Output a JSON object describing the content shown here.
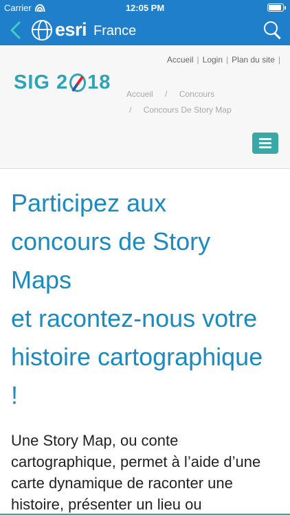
{
  "status_bar": {
    "carrier": "Carrier",
    "time": "12:05 PM",
    "battery_level": 0.9
  },
  "nav": {
    "brand": "esri",
    "region": "France",
    "colors": {
      "bar": "#1f7fcb"
    }
  },
  "header": {
    "top_links": [
      "Accueil",
      "Login",
      "Plan du site"
    ],
    "logo_text_left": "SIG 2",
    "logo_text_right": "18",
    "breadcrumb": [
      "Accueil",
      "Concours",
      "Concours De Story Map"
    ]
  },
  "content": {
    "title_lines": [
      "Participez aux",
      "concours de Story",
      "Maps",
      "et racontez-nous votre",
      "histoire cartographique",
      "!"
    ],
    "intro_lines": [
      "Une Story Map, ou conte",
      "cartographique, permet à l’aide d’une",
      "carte dynamique de raconter une",
      "histoire, présenter un lieu ou"
    ]
  }
}
